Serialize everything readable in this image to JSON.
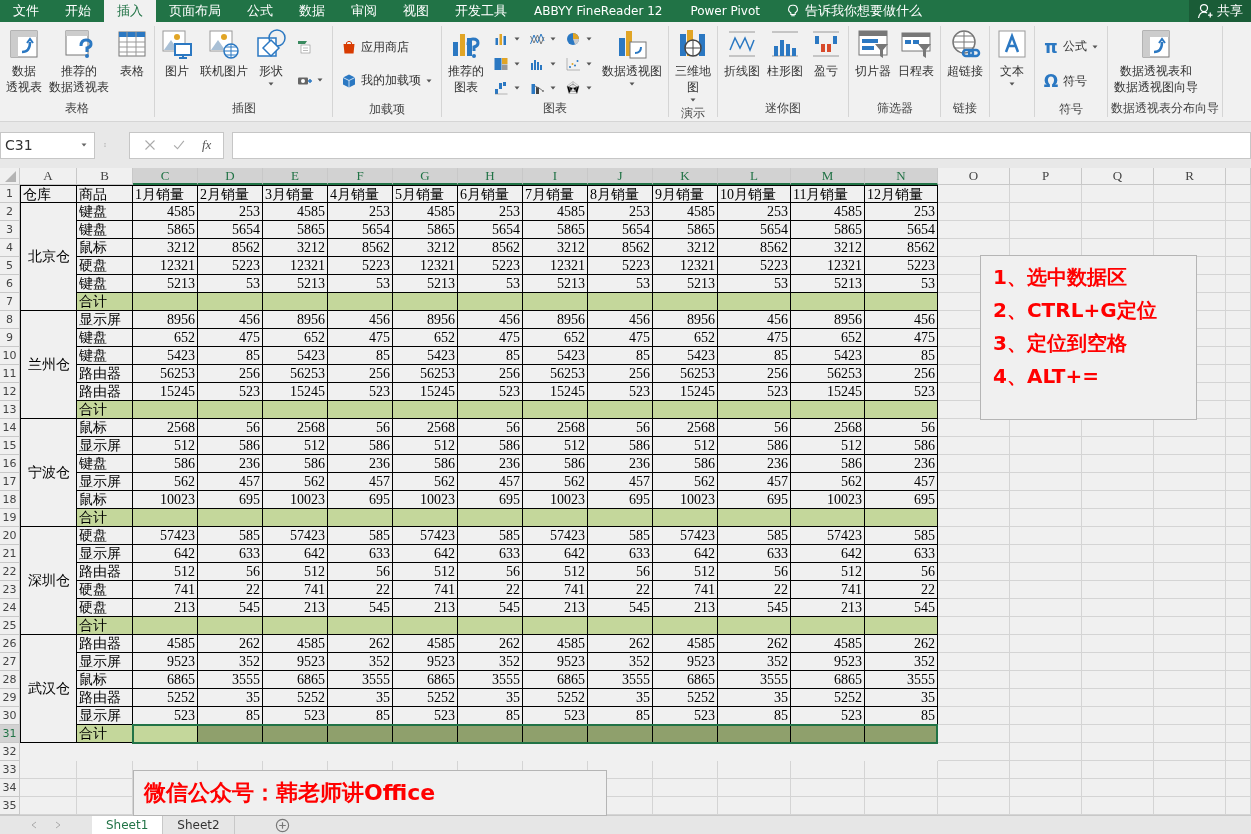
{
  "tabs": [
    {
      "label": "文件",
      "selected": false
    },
    {
      "label": "开始",
      "selected": false
    },
    {
      "label": "插入",
      "selected": true
    },
    {
      "label": "页面布局",
      "selected": false
    },
    {
      "label": "公式",
      "selected": false
    },
    {
      "label": "数据",
      "selected": false
    },
    {
      "label": "审阅",
      "selected": false
    },
    {
      "label": "视图",
      "selected": false
    },
    {
      "label": "开发工具",
      "selected": false
    },
    {
      "label": "ABBYY FineReader 12",
      "selected": false
    },
    {
      "label": "Power Pivot",
      "selected": false
    }
  ],
  "tell_me": "告诉我你想要做什么",
  "share": "共享",
  "ribbon": [
    {
      "label": "表格",
      "items": [
        {
          "kind": "large",
          "lines": [
            "数据",
            "透视表"
          ],
          "menu": false
        },
        {
          "kind": "large",
          "lines": [
            "推荐的",
            "数据透视表"
          ],
          "menu": false
        },
        {
          "kind": "large",
          "lines": [
            "表格"
          ],
          "menu": false
        }
      ]
    },
    {
      "label": "插图",
      "items": [
        {
          "kind": "large",
          "lines": [
            "图片"
          ],
          "menu": false
        },
        {
          "kind": "large",
          "lines": [
            "联机图片"
          ],
          "menu": false
        },
        {
          "kind": "large",
          "lines": [
            "形状"
          ],
          "menu": true
        },
        {
          "kind": "icon",
          "menu": false
        },
        {
          "kind": "icon",
          "menu": true
        }
      ]
    },
    {
      "label": "加载项",
      "items": [
        {
          "kind": "small",
          "lines": [
            "应用商店"
          ],
          "menu": false
        },
        {
          "kind": "small",
          "lines": [
            "我的加载项"
          ],
          "menu": true
        }
      ]
    },
    {
      "label": "图表",
      "items": [
        {
          "kind": "large",
          "lines": [
            "推荐的",
            "图表"
          ],
          "menu": false
        },
        {
          "kind": "icon",
          "menu": true
        },
        {
          "kind": "icon",
          "menu": true
        },
        {
          "kind": "icon",
          "menu": true
        },
        {
          "kind": "icon",
          "menu": true
        },
        {
          "kind": "icon",
          "menu": true
        },
        {
          "kind": "icon",
          "menu": true
        },
        {
          "kind": "icon",
          "menu": true
        },
        {
          "kind": "icon",
          "menu": true
        },
        {
          "kind": "icon",
          "menu": true
        },
        {
          "kind": "large",
          "lines": [
            "数据透视图"
          ],
          "menu": true
        }
      ]
    },
    {
      "label": "演示",
      "items": [
        {
          "kind": "large",
          "lines": [
            "三维地",
            "图"
          ],
          "menu": true
        }
      ]
    },
    {
      "label": "迷你图",
      "items": [
        {
          "kind": "large",
          "lines": [
            "折线图"
          ],
          "menu": false
        },
        {
          "kind": "large",
          "lines": [
            "柱形图"
          ],
          "menu": false
        },
        {
          "kind": "large",
          "lines": [
            "盈亏"
          ],
          "menu": false
        }
      ]
    },
    {
      "label": "筛选器",
      "items": [
        {
          "kind": "large",
          "lines": [
            "切片器"
          ],
          "menu": false
        },
        {
          "kind": "large",
          "lines": [
            "日程表"
          ],
          "menu": false
        }
      ]
    },
    {
      "label": "链接",
      "items": [
        {
          "kind": "large",
          "lines": [
            "超链接"
          ],
          "menu": false
        }
      ]
    },
    {
      "items": [
        {
          "kind": "large",
          "lines": [
            "文本"
          ],
          "menu": true
        }
      ]
    },
    {
      "label": "符号",
      "items": [
        {
          "kind": "small",
          "glyph": "π",
          "lines": [
            "公式"
          ],
          "menu": true
        },
        {
          "kind": "small",
          "glyph": "Ω",
          "lines": [
            "符号"
          ],
          "menu": false
        }
      ]
    },
    {
      "label": "数据透视表分布向导",
      "items": [
        {
          "kind": "large",
          "lines": [
            "数据透视表和",
            "数据透视图向导"
          ],
          "menu": false
        }
      ]
    }
  ],
  "formula_bar": {
    "name_box": "C31",
    "fx": "fx"
  },
  "sheet": {
    "columns": [
      {
        "label": "A",
        "selected": false
      },
      {
        "label": "B",
        "selected": false
      },
      {
        "label": "C",
        "selected": true
      },
      {
        "label": "D",
        "selected": true
      },
      {
        "label": "E",
        "selected": true
      },
      {
        "label": "F",
        "selected": true
      },
      {
        "label": "G",
        "selected": true
      },
      {
        "label": "H",
        "selected": true
      },
      {
        "label": "I",
        "selected": true
      },
      {
        "label": "J",
        "selected": true
      },
      {
        "label": "K",
        "selected": true
      },
      {
        "label": "L",
        "selected": true
      },
      {
        "label": "M",
        "selected": true
      },
      {
        "label": "N",
        "selected": true
      },
      {
        "label": "O",
        "selected": false
      },
      {
        "label": "P",
        "selected": false
      },
      {
        "label": "Q",
        "selected": false
      },
      {
        "label": "R",
        "selected": false
      }
    ],
    "row_numbers": [
      {
        "label": "1",
        "selected": false
      },
      {
        "label": "2",
        "selected": false
      },
      {
        "label": "3",
        "selected": false
      },
      {
        "label": "4",
        "selected": false
      },
      {
        "label": "5",
        "selected": false
      },
      {
        "label": "6",
        "selected": false
      },
      {
        "label": "7",
        "selected": false
      },
      {
        "label": "8",
        "selected": false
      },
      {
        "label": "9",
        "selected": false
      },
      {
        "label": "10",
        "selected": false
      },
      {
        "label": "11",
        "selected": false
      },
      {
        "label": "12",
        "selected": false
      },
      {
        "label": "13",
        "selected": false
      },
      {
        "label": "14",
        "selected": false
      },
      {
        "label": "15",
        "selected": false
      },
      {
        "label": "16",
        "selected": false
      },
      {
        "label": "17",
        "selected": false
      },
      {
        "label": "18",
        "selected": false
      },
      {
        "label": "19",
        "selected": false
      },
      {
        "label": "20",
        "selected": false
      },
      {
        "label": "21",
        "selected": false
      },
      {
        "label": "22",
        "selected": false
      },
      {
        "label": "23",
        "selected": false
      },
      {
        "label": "24",
        "selected": false
      },
      {
        "label": "25",
        "selected": false
      },
      {
        "label": "26",
        "selected": false
      },
      {
        "label": "27",
        "selected": false
      },
      {
        "label": "28",
        "selected": false
      },
      {
        "label": "29",
        "selected": false
      },
      {
        "label": "30",
        "selected": false
      },
      {
        "label": "31",
        "selected": true
      },
      {
        "label": "32",
        "selected": false
      },
      {
        "label": "33",
        "selected": false
      },
      {
        "label": "34",
        "selected": false
      },
      {
        "label": "35",
        "selected": false
      }
    ],
    "header": [
      "仓库",
      "商品",
      "1月销量",
      "2月销量",
      "3月销量",
      "4月销量",
      "5月销量",
      "6月销量",
      "7月销量",
      "8月销量",
      "9月销量",
      "10月销量",
      "11月销量",
      "12月销量"
    ],
    "warehouses": [
      {
        "name": "北京仓",
        "rows": [
          {
            "product": "键盘",
            "values": [
              "4585",
              "253",
              "4585",
              "253",
              "4585",
              "253",
              "4585",
              "253",
              "4585",
              "253",
              "4585",
              "253"
            ]
          },
          {
            "product": "键盘",
            "values": [
              "5865",
              "5654",
              "5865",
              "5654",
              "5865",
              "5654",
              "5865",
              "5654",
              "5865",
              "5654",
              "5865",
              "5654"
            ]
          },
          {
            "product": "鼠标",
            "values": [
              "3212",
              "8562",
              "3212",
              "8562",
              "3212",
              "8562",
              "3212",
              "8562",
              "3212",
              "8562",
              "3212",
              "8562"
            ]
          },
          {
            "product": "硬盘",
            "values": [
              "12321",
              "5223",
              "12321",
              "5223",
              "12321",
              "5223",
              "12321",
              "5223",
              "12321",
              "5223",
              "12321",
              "5223"
            ]
          },
          {
            "product": "键盘",
            "values": [
              "5213",
              "53",
              "5213",
              "53",
              "5213",
              "53",
              "5213",
              "53",
              "5213",
              "53",
              "5213",
              "53"
            ]
          }
        ],
        "total": {
          "label": "合计",
          "selected": false
        }
      },
      {
        "name": "兰州仓",
        "rows": [
          {
            "product": "显示屏",
            "values": [
              "8956",
              "456",
              "8956",
              "456",
              "8956",
              "456",
              "8956",
              "456",
              "8956",
              "456",
              "8956",
              "456"
            ]
          },
          {
            "product": "键盘",
            "values": [
              "652",
              "475",
              "652",
              "475",
              "652",
              "475",
              "652",
              "475",
              "652",
              "475",
              "652",
              "475"
            ]
          },
          {
            "product": "键盘",
            "values": [
              "5423",
              "85",
              "5423",
              "85",
              "5423",
              "85",
              "5423",
              "85",
              "5423",
              "85",
              "5423",
              "85"
            ]
          },
          {
            "product": "路由器",
            "values": [
              "56253",
              "256",
              "56253",
              "256",
              "56253",
              "256",
              "56253",
              "256",
              "56253",
              "256",
              "56253",
              "256"
            ]
          },
          {
            "product": "路由器",
            "values": [
              "15245",
              "523",
              "15245",
              "523",
              "15245",
              "523",
              "15245",
              "523",
              "15245",
              "523",
              "15245",
              "523"
            ]
          }
        ],
        "total": {
          "label": "合计",
          "selected": false
        }
      },
      {
        "name": "宁波仓",
        "rows": [
          {
            "product": "鼠标",
            "values": [
              "2568",
              "56",
              "2568",
              "56",
              "2568",
              "56",
              "2568",
              "56",
              "2568",
              "56",
              "2568",
              "56"
            ]
          },
          {
            "product": "显示屏",
            "values": [
              "512",
              "586",
              "512",
              "586",
              "512",
              "586",
              "512",
              "586",
              "512",
              "586",
              "512",
              "586"
            ]
          },
          {
            "product": "键盘",
            "values": [
              "586",
              "236",
              "586",
              "236",
              "586",
              "236",
              "586",
              "236",
              "586",
              "236",
              "586",
              "236"
            ]
          },
          {
            "product": "显示屏",
            "values": [
              "562",
              "457",
              "562",
              "457",
              "562",
              "457",
              "562",
              "457",
              "562",
              "457",
              "562",
              "457"
            ]
          },
          {
            "product": "鼠标",
            "values": [
              "10023",
              "695",
              "10023",
              "695",
              "10023",
              "695",
              "10023",
              "695",
              "10023",
              "695",
              "10023",
              "695"
            ]
          }
        ],
        "total": {
          "label": "合计",
          "selected": false
        }
      },
      {
        "name": "深圳仓",
        "rows": [
          {
            "product": "硬盘",
            "values": [
              "57423",
              "585",
              "57423",
              "585",
              "57423",
              "585",
              "57423",
              "585",
              "57423",
              "585",
              "57423",
              "585"
            ]
          },
          {
            "product": "显示屏",
            "values": [
              "642",
              "633",
              "642",
              "633",
              "642",
              "633",
              "642",
              "633",
              "642",
              "633",
              "642",
              "633"
            ]
          },
          {
            "product": "路由器",
            "values": [
              "512",
              "56",
              "512",
              "56",
              "512",
              "56",
              "512",
              "56",
              "512",
              "56",
              "512",
              "56"
            ]
          },
          {
            "product": "硬盘",
            "values": [
              "741",
              "22",
              "741",
              "22",
              "741",
              "22",
              "741",
              "22",
              "741",
              "22",
              "741",
              "22"
            ]
          },
          {
            "product": "硬盘",
            "values": [
              "213",
              "545",
              "213",
              "545",
              "213",
              "545",
              "213",
              "545",
              "213",
              "545",
              "213",
              "545"
            ]
          }
        ],
        "total": {
          "label": "合计",
          "selected": false
        }
      },
      {
        "name": "武汉仓",
        "rows": [
          {
            "product": "路由器",
            "values": [
              "4585",
              "262",
              "4585",
              "262",
              "4585",
              "262",
              "4585",
              "262",
              "4585",
              "262",
              "4585",
              "262"
            ]
          },
          {
            "product": "显示屏",
            "values": [
              "9523",
              "352",
              "9523",
              "352",
              "9523",
              "352",
              "9523",
              "352",
              "9523",
              "352",
              "9523",
              "352"
            ]
          },
          {
            "product": "鼠标",
            "values": [
              "6865",
              "3555",
              "6865",
              "3555",
              "6865",
              "3555",
              "6865",
              "3555",
              "6865",
              "3555",
              "6865",
              "3555"
            ]
          },
          {
            "product": "路由器",
            "values": [
              "5252",
              "35",
              "5252",
              "35",
              "5252",
              "35",
              "5252",
              "35",
              "5252",
              "35",
              "5252",
              "35"
            ]
          },
          {
            "product": "显示屏",
            "values": [
              "523",
              "85",
              "523",
              "85",
              "523",
              "85",
              "523",
              "85",
              "523",
              "85",
              "523",
              "85"
            ]
          }
        ],
        "total": {
          "label": "合计",
          "selected": true
        }
      }
    ],
    "notes": [
      "1、选中数据区",
      "2、CTRL+G定位",
      "3、定位到空格",
      "4、ALT+="
    ],
    "caption": "微信公众号：韩老师讲Office"
  },
  "sheet_tabs": [
    {
      "label": "Sheet1",
      "selected": true
    },
    {
      "label": "Sheet2",
      "selected": false
    }
  ]
}
